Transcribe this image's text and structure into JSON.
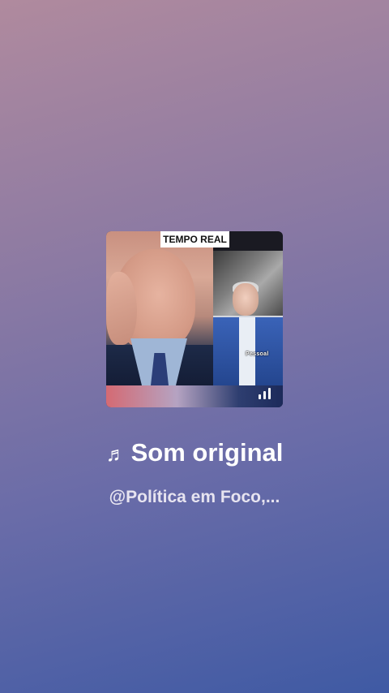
{
  "cover": {
    "tag": "TEMPO REAL",
    "caption": "Pessoal"
  },
  "audio": {
    "note_icon": "♬",
    "title": "Som original",
    "author": "@Política em Foco,..."
  }
}
